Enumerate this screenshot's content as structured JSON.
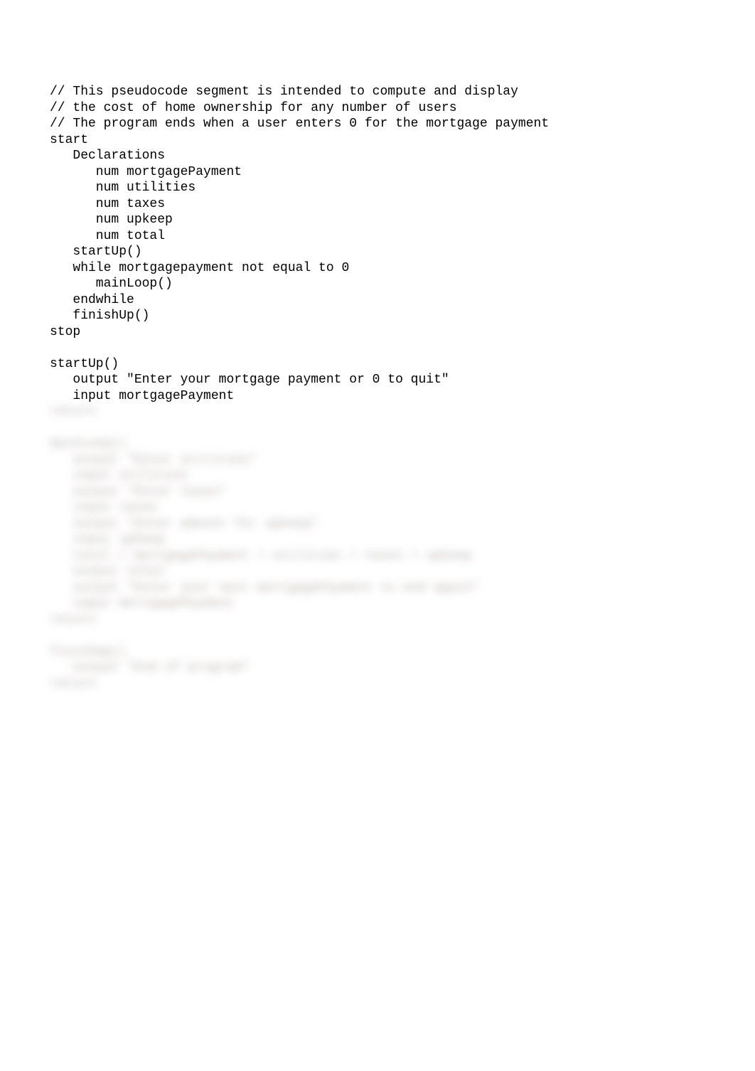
{
  "code": {
    "comment1": "// This pseudocode segment is intended to compute and display",
    "comment2": "// the cost of home ownership for any number of users",
    "comment3": "// The program ends when a user enters 0 for the mortgage payment",
    "start": "start",
    "declarations": "   Declarations",
    "declMortgage": "      num mortgagePayment",
    "declUtilities": "      num utilities",
    "declTaxes": "      num taxes",
    "declUpkeep": "      num upkeep",
    "declTotal": "      num total",
    "callStartUp": "   startUp()",
    "whileLine": "   while mortgagepayment not equal to 0",
    "callMainLoop": "      mainLoop()",
    "endwhile": "   endwhile",
    "callFinishUp": "   finishUp()",
    "stop": "stop",
    "blank1": "",
    "startUpHeader": "startUp()",
    "startUpOutput": "   output \"Enter your mortgage payment or 0 to quit\"",
    "startUpInput": "   input mortgagePayment",
    "blurred": {
      "b1": "return",
      "b2": "",
      "b3": "mainLoop()",
      "b4": "   output \"Enter utilities\"",
      "b5": "   input utilities",
      "b6": "   output \"Enter taxes\"",
      "b7": "   input taxes",
      "b8": "   output \"Enter amount for upkeep\"",
      "b9": "   input upkeep",
      "b10": "   total = mortgagePayment + utilities + taxes + upkeep",
      "b11": "   output total",
      "b12": "   output \"Enter your next mortgagePayment to end again\"",
      "b13": "   input mortgagePayment",
      "b14": "return",
      "b15": "",
      "b16": "finishUp()",
      "b17": "   output \"End of program\"",
      "b18": "return"
    }
  }
}
